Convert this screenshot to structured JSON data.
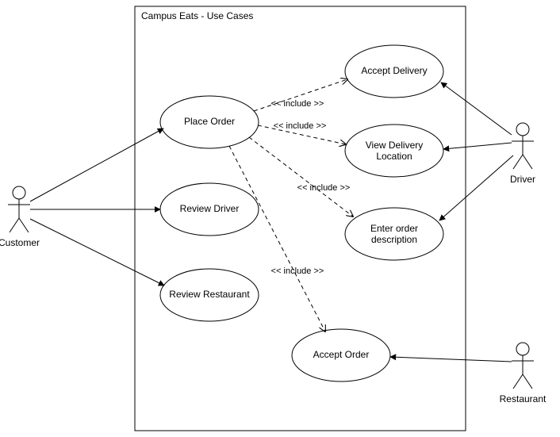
{
  "diagram": {
    "title": "Campus Eats - Use Cases",
    "actors": {
      "customer": "Customer",
      "driver": "Driver",
      "restaurant": "Restaurant"
    },
    "usecases": {
      "place_order": "Place Order",
      "review_driver": "Review Driver",
      "review_restaurant": "Review Restaurant",
      "accept_delivery": "Accept Delivery",
      "view_delivery_location_l1": "View Delivery",
      "view_delivery_location_l2": "Location",
      "enter_order_desc_l1": "Enter order",
      "enter_order_desc_l2": "description",
      "accept_order": "Accept Order"
    },
    "include_label": "<< include >>"
  }
}
